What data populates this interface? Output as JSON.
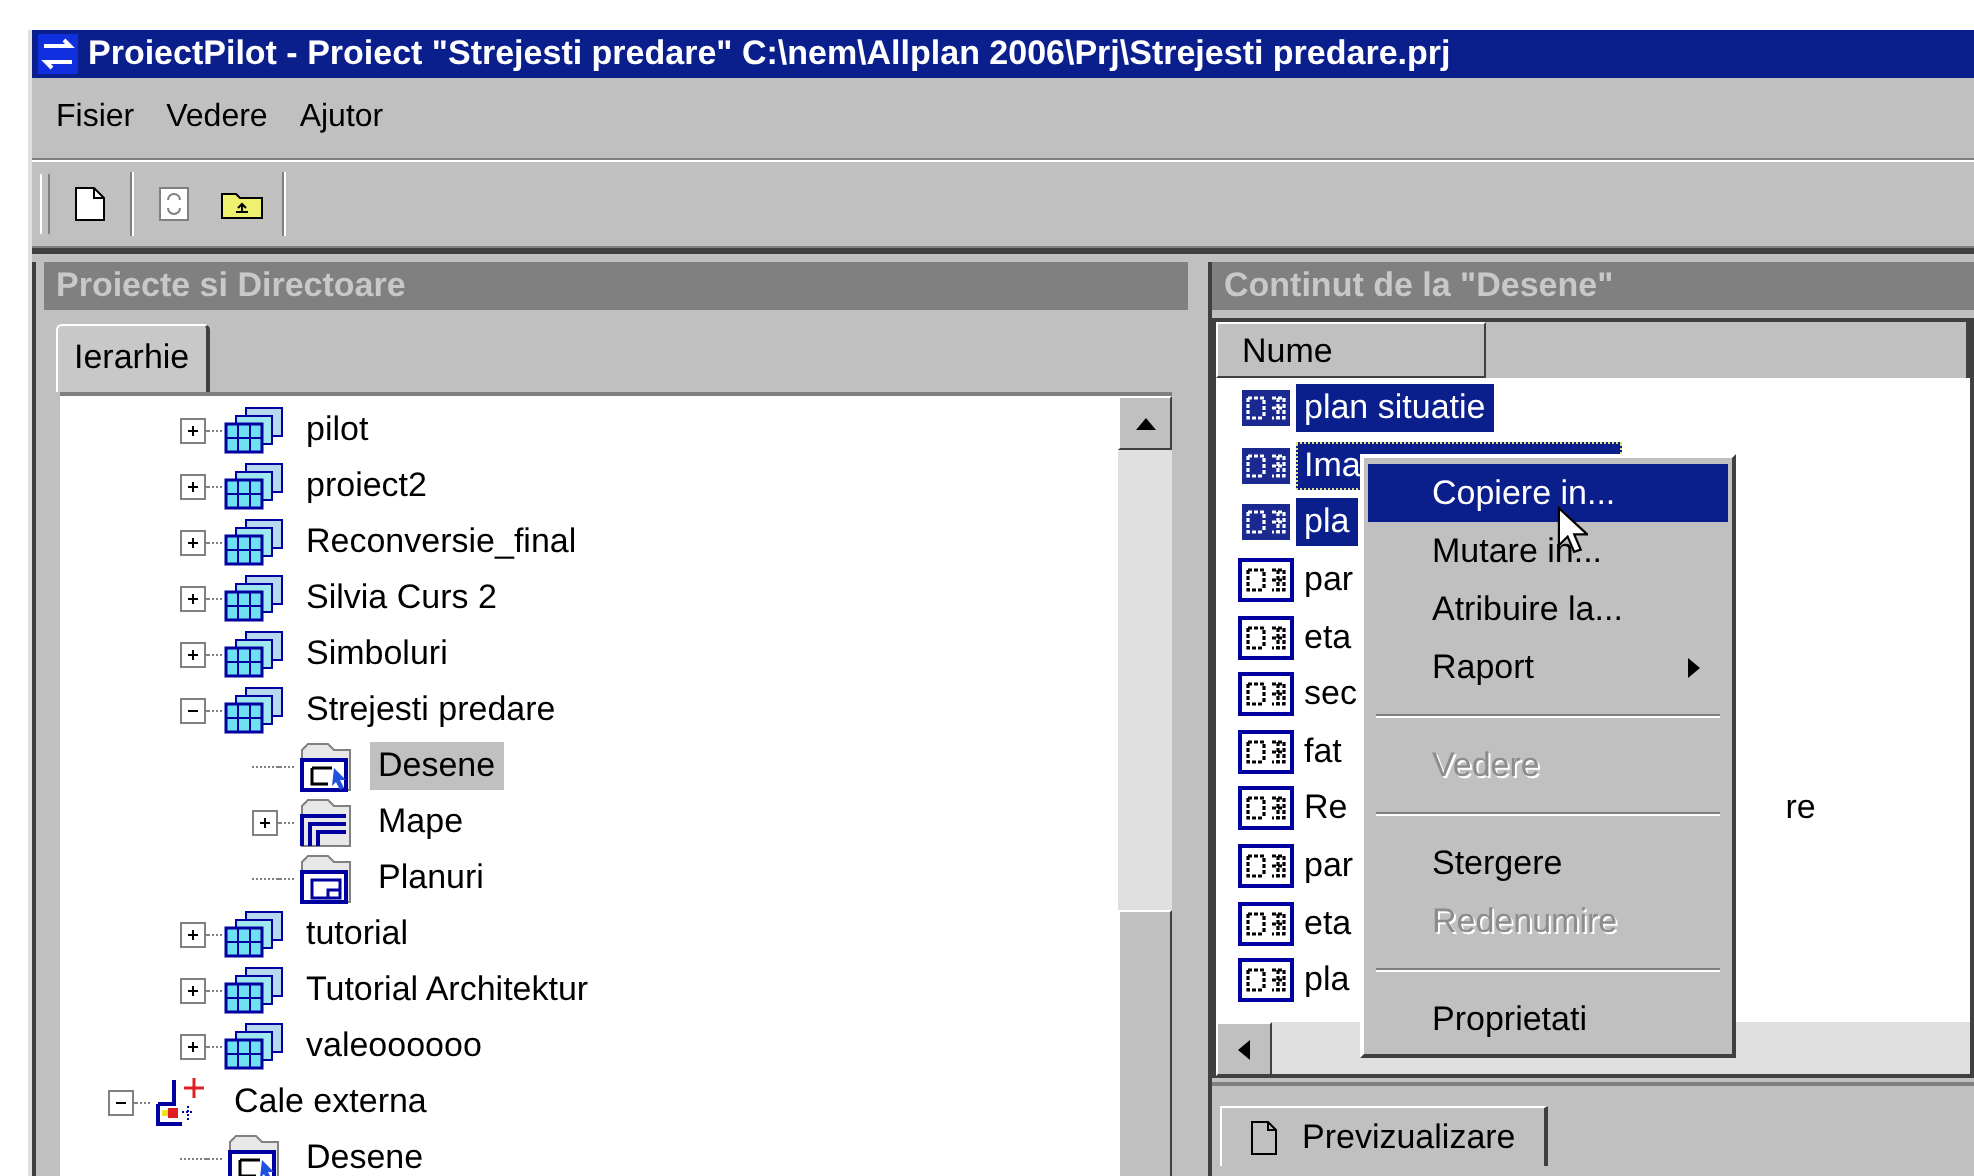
{
  "window": {
    "title": "ProiectPilot - Proiect \"Strejesti predare\" C:\\nem\\Allplan 2006\\Prj\\Strejesti predare.prj"
  },
  "menu": [
    "Fisier",
    "Vedere",
    "Ajutor"
  ],
  "toolbar": [
    {
      "kind": "new",
      "disabled": false
    },
    {
      "kind": "refresh",
      "disabled": true
    },
    {
      "kind": "up",
      "disabled": false
    }
  ],
  "left_panel": {
    "title": "Proiecte si Directoare",
    "tabs": [
      {
        "label": "Ierarhie",
        "selected": true
      }
    ],
    "tree": [
      {
        "children": [
          {
            "label": "pilot",
            "kind": "project",
            "expanded": false,
            "selected": false
          },
          {
            "label": "proiect2",
            "kind": "project",
            "expanded": false,
            "selected": false
          },
          {
            "label": "Reconversie_final",
            "kind": "project",
            "expanded": false,
            "selected": false
          },
          {
            "label": "Silvia Curs 2",
            "kind": "project",
            "expanded": false,
            "selected": false
          },
          {
            "label": "Simboluri",
            "kind": "project",
            "expanded": false,
            "selected": false
          },
          {
            "label": "Strejesti predare",
            "kind": "project",
            "expanded": true,
            "selected": false,
            "children": [
              {
                "label": "Desene",
                "kind": "drawings",
                "selected": true
              },
              {
                "label": "Mape",
                "kind": "folders",
                "expanded": false,
                "selected": false
              },
              {
                "label": "Planuri",
                "kind": "plans",
                "selected": false
              }
            ]
          },
          {
            "label": "tutorial",
            "kind": "project",
            "expanded": false,
            "selected": false
          },
          {
            "label": "Tutorial Architektur",
            "kind": "project",
            "expanded": false,
            "selected": false
          },
          {
            "label": "valeoooooo",
            "kind": "project",
            "expanded": false,
            "selected": false
          }
        ]
      },
      {
        "label": "Cale externa",
        "kind": "external",
        "expanded": true,
        "selected": false,
        "children": [
          {
            "label": "Desene",
            "kind": "drawings",
            "selected": false
          }
        ]
      }
    ]
  },
  "right_panel": {
    "title": "Continut de la \"Desene\"",
    "columns": [
      "Nume"
    ],
    "rows": [
      {
        "name": "plan situatie",
        "selected": true,
        "focused": false
      },
      {
        "name": "Ima",
        "selected": true,
        "focused": true
      },
      {
        "name": "pla",
        "selected": true,
        "focused": false
      },
      {
        "name": "par",
        "selected": false,
        "focused": false
      },
      {
        "name": "eta",
        "selected": false,
        "focused": false
      },
      {
        "name": "sec",
        "selected": false,
        "focused": false
      },
      {
        "name": "fat",
        "selected": false,
        "focused": false
      },
      {
        "name": "Re",
        "tail": "re",
        "selected": false,
        "focused": false
      },
      {
        "name": "par",
        "selected": false,
        "focused": false
      },
      {
        "name": "eta",
        "selected": false,
        "focused": false
      },
      {
        "name": "pla",
        "selected": false,
        "focused": false
      }
    ],
    "bottom_tabs": [
      {
        "label": "Previzualizare",
        "selected": true
      }
    ]
  },
  "context_menu": [
    {
      "kind": "item",
      "label": "Copiere in...",
      "selected": true,
      "disabled": false
    },
    {
      "kind": "item",
      "label": "Mutare in...",
      "selected": false,
      "disabled": false
    },
    {
      "kind": "item",
      "label": "Atribuire la...",
      "selected": false,
      "disabled": false
    },
    {
      "kind": "submenu",
      "label": "Raport",
      "selected": false,
      "disabled": false
    },
    {
      "kind": "separator"
    },
    {
      "kind": "item",
      "label": "Vedere",
      "selected": false,
      "disabled": true
    },
    {
      "kind": "separator"
    },
    {
      "kind": "item",
      "label": "Stergere",
      "selected": false,
      "disabled": false
    },
    {
      "kind": "item",
      "label": "Redenumire",
      "selected": false,
      "disabled": true
    },
    {
      "kind": "separator"
    },
    {
      "kind": "item",
      "label": "Proprietati",
      "selected": false,
      "disabled": false
    }
  ]
}
